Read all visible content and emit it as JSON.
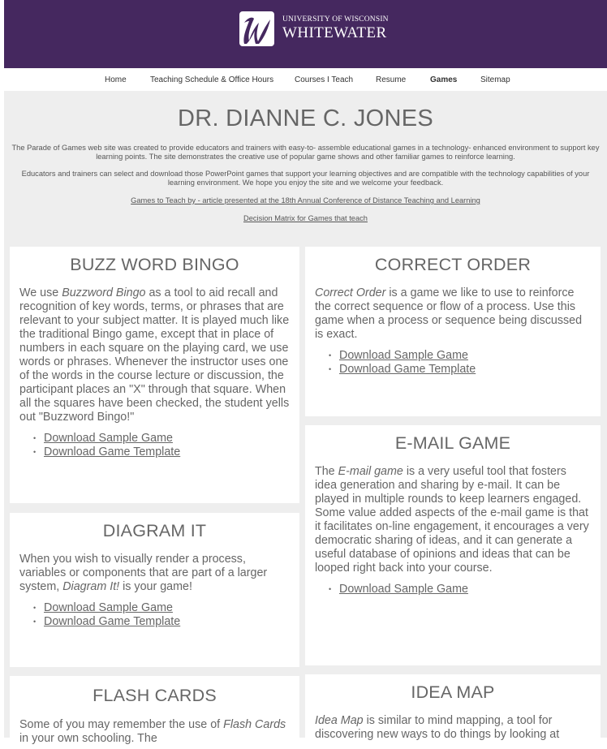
{
  "header": {
    "logo_icon": "uw-whitewater-logo-icon",
    "logo_line1": "UNIVERSITY OF WISCONSIN",
    "logo_line2": "WHITEWATER",
    "background_color": "#45285f"
  },
  "nav": {
    "items": [
      {
        "label": "Home",
        "active": false
      },
      {
        "label": "Teaching Schedule & Office Hours",
        "active": false
      },
      {
        "label": "Courses I Teach",
        "active": false
      },
      {
        "label": "Resume",
        "active": false
      },
      {
        "label": "Games",
        "active": true
      },
      {
        "label": "Sitemap",
        "active": false
      }
    ]
  },
  "page": {
    "title": "DR. DIANNE C. JONES",
    "intro_1": "The Parade of Games web site was created to provide educators and trainers with easy-to- assemble educational games in a technology- enhanced environment to support key learning points.   The site demonstrates the creative use of popular game shows and other familiar games to reinforce learning.",
    "intro_2": "Educators and trainers can select and download those PowerPoint games that support your learning objectives and are compatible with the technology capabilities of your learning environment. We hope you enjoy the site and we welcome your feedback.",
    "link_1": "Games to Teach by -   article presented at the 18th Annual Conference of Distance Teaching and Learning",
    "link_2": "Decision Matrix for Games that teach"
  },
  "games": {
    "buzz": {
      "title": "BUZZ WORD BINGO",
      "pre": "We use ",
      "em": "Buzzword Bingo",
      "post": " as a tool to aid recall and recognition of key words, terms, or phrases that are relevant to your subject matter. It is played much like the traditional Bingo game, except that in place of numbers in each square on the playing card, we use words or phrases. Whenever the instructor uses one of the words in the course lecture or discussion, the participant places an \"X\" through that square. When all the squares have been checked, the student yells out \"Buzzword Bingo!\"",
      "links": [
        "Download Sample Game",
        "Download Game Template"
      ]
    },
    "order": {
      "title": "CORRECT ORDER",
      "pre": "",
      "em": "Correct Order",
      "post": " is a game we like to use to reinforce the correct sequence or flow of a process. Use this game when a process or sequence being discussed is exact.",
      "links": [
        "Download Sample Game",
        "Download Game Template"
      ]
    },
    "email": {
      "title": "E-MAIL GAME",
      "pre": "The ",
      "em": "E-mail game",
      "post": " is a very useful tool that fosters idea generation and sharing by e-mail. It can be played in multiple rounds to keep learners engaged. Some value added aspects of the e-mail game is that it facilitates on-line engagement, it encourages a very democratic sharing of ideas, and it can generate a useful database of opinions and ideas that can be looped right back into your course.",
      "links": [
        "Download Sample Game"
      ]
    },
    "diagram": {
      "title": "DIAGRAM IT",
      "pre": "When you wish to visually render a process, variables or components that are part of a larger system, ",
      "em": "Diagram It!",
      "post": " is your game!",
      "links": [
        "Download Sample Game",
        "Download Game Template"
      ]
    },
    "flash": {
      "title": "FLASH CARDS",
      "pre": "Some of you may remember the use of ",
      "em": "Flash Cards",
      "post": " in your own schooling. The"
    },
    "idea": {
      "title": "IDEA MAP",
      "pre": "",
      "em": "Idea Map",
      "post": " is similar to mind mapping, a tool for discovering new ways to do things by looking at"
    }
  }
}
